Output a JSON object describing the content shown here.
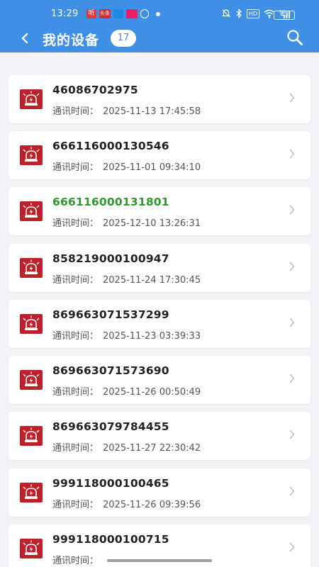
{
  "status_bar": {
    "time": "13:29",
    "left_icons": [
      "听",
      "头条",
      "app",
      "app",
      "●"
    ],
    "right_icons": [
      "🔕",
      "bluetooth",
      "HD",
      "wifi",
      "5G"
    ],
    "battery": "43"
  },
  "header": {
    "title": "我的设备",
    "count": "17",
    "back_icon": "back-chevron-icon",
    "search_icon": "search-icon"
  },
  "devices": [
    {
      "id": "46086702975",
      "label": "通讯时间：",
      "time": "2025-11-13 17:45:58",
      "highlight": false
    },
    {
      "id": "666116000130546",
      "label": "通讯时间：",
      "time": "2025-11-01 09:34:10",
      "highlight": false
    },
    {
      "id": "666116000131801",
      "label": "通讯时间：",
      "time": "2025-12-10 13:26:31",
      "highlight": true
    },
    {
      "id": "858219000100947",
      "label": "通讯时间：",
      "time": "2025-11-24 17:30:45",
      "highlight": false
    },
    {
      "id": "869663071537299",
      "label": "通讯时间：",
      "time": "2025-11-23 03:39:33",
      "highlight": false
    },
    {
      "id": "869663071573690",
      "label": "通讯时间：",
      "time": "2025-11-26 00:50:49",
      "highlight": false
    },
    {
      "id": "869663079784455",
      "label": "通讯时间：",
      "time": "2025-11-27 22:30:42",
      "highlight": false
    },
    {
      "id": "999118000100465",
      "label": "通讯时间：",
      "time": "2025-11-26 09:39:56",
      "highlight": false
    },
    {
      "id": "999118000100715",
      "label": "通讯时间：",
      "time": "",
      "highlight": false
    }
  ],
  "colors": {
    "header_bg": "#3f8fe6",
    "device_icon_bg": "#c0202a",
    "highlight_text": "#2d9a2d"
  }
}
